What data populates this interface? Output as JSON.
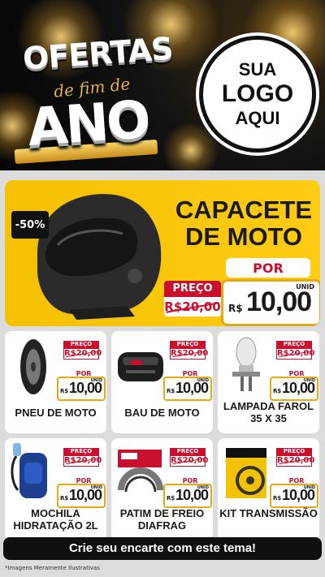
{
  "header": {
    "title_line1": "OFERTAS",
    "title_line2": "de fim de",
    "title_line3": "ANO",
    "logo_lines": [
      "SUA",
      "LOGO",
      "AQUI"
    ]
  },
  "hero": {
    "discount": "-50%",
    "title": "CAPACETE DE MOTO",
    "por_label": "POR",
    "preco_label": "PREÇO",
    "old_price": "R$20,00",
    "currency": "R$",
    "price": "10,00",
    "unit": "UNID"
  },
  "products": [
    {
      "name": "PNEU DE MOTO",
      "preco_label": "PREÇO",
      "old_price": "R$20,00",
      "por_label": "POR",
      "currency": "R$",
      "price": "10,00",
      "unit": "UNID",
      "icon": "tire-icon"
    },
    {
      "name": "BAU DE MOTO",
      "preco_label": "PREÇO",
      "old_price": "R$20,00",
      "por_label": "POR",
      "currency": "R$",
      "price": "10,00",
      "unit": "UNID",
      "icon": "top-case-icon"
    },
    {
      "name": "LAMPADA FAROL 35 X 35",
      "preco_label": "PREÇO",
      "old_price": "R$20,00",
      "por_label": "POR",
      "currency": "R$",
      "price": "10,00",
      "unit": "UNID",
      "icon": "headlight-bulb-icon"
    },
    {
      "name": "MOCHILA HIDRATAÇÃO 2L",
      "preco_label": "PREÇO",
      "old_price": "R$20,00",
      "por_label": "POR",
      "currency": "R$",
      "price": "10,00",
      "unit": "UNID",
      "icon": "backpack-icon"
    },
    {
      "name": "PATIM DE FREIO DIAFRAG",
      "preco_label": "PREÇO",
      "old_price": "R$20,00",
      "por_label": "POR",
      "currency": "R$",
      "price": "10,00",
      "unit": "UNID",
      "icon": "brake-shoe-icon"
    },
    {
      "name": "KIT TRANSMISSÃO",
      "preco_label": "PREÇO",
      "old_price": "R$20,00",
      "por_label": "POR",
      "currency": "R$",
      "price": "10,00",
      "unit": "UNID",
      "icon": "chain-kit-icon"
    }
  ],
  "cta": "Crie seu encarte com este tema!",
  "footnote": "*Imagens Meramente Ilustrativas",
  "colors": {
    "accent_yellow": "#f5c000",
    "price_red": "#c8102e",
    "gold_border": "#e3a916",
    "dark": "#101010"
  }
}
